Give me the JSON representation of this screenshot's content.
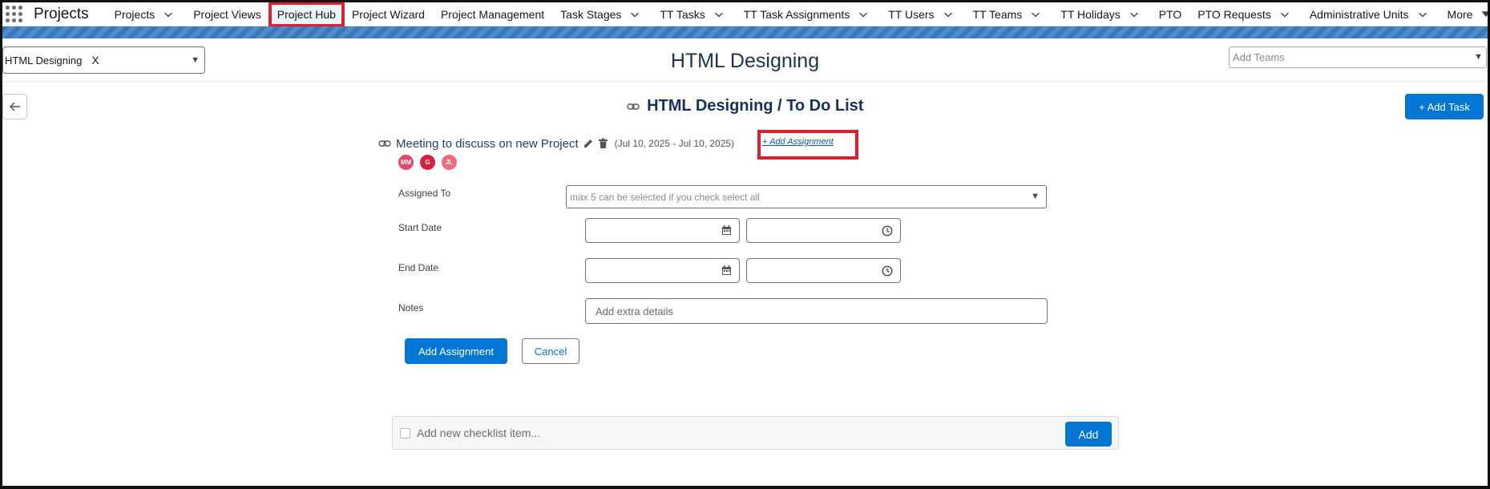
{
  "app": {
    "name": "Projects"
  },
  "nav": {
    "items": [
      {
        "label": "Projects",
        "dropdown": true
      },
      {
        "label": "Project Views",
        "dropdown": false
      },
      {
        "label": "Project Hub",
        "dropdown": false,
        "active": true,
        "highlighted": true
      },
      {
        "label": "Project Wizard",
        "dropdown": false
      },
      {
        "label": "Project Management",
        "dropdown": false
      },
      {
        "label": "Task Stages",
        "dropdown": true
      },
      {
        "label": "TT Tasks",
        "dropdown": true
      },
      {
        "label": "TT Task Assignments",
        "dropdown": true
      },
      {
        "label": "TT Users",
        "dropdown": true
      },
      {
        "label": "TT Teams",
        "dropdown": true
      },
      {
        "label": "TT Holidays",
        "dropdown": true
      },
      {
        "label": "PTO",
        "dropdown": false
      },
      {
        "label": "PTO Requests",
        "dropdown": true
      },
      {
        "label": "Administrative Units",
        "dropdown": true
      },
      {
        "label": "More",
        "dropdown": true
      }
    ]
  },
  "header": {
    "project_select_value": "HTML Designing",
    "project_select_clear": "X",
    "title": "HTML Designing",
    "teams_placeholder": "Add Teams"
  },
  "list": {
    "title": "HTML Designing  / To Do List",
    "add_task_label": "+ Add Task"
  },
  "task": {
    "name": "Meeting to discuss on new Project",
    "dates": "(Jul 10, 2025 - Jul 10, 2025)",
    "add_assignment_link": "+ Add Assignment",
    "assignees": [
      {
        "initials": "MM",
        "color": "#e8456b"
      },
      {
        "initials": "G",
        "color": "#d6203d"
      },
      {
        "initials": "JL",
        "color": "#ef6b7d"
      }
    ]
  },
  "form": {
    "assigned_to_label": "Assigned To",
    "assigned_to_placeholder": "max 5 can be selected if you check select all",
    "start_date_label": "Start Date",
    "end_date_label": "End Date",
    "notes_label": "Notes",
    "notes_placeholder": "Add extra details",
    "submit_label": "Add Assignment",
    "cancel_label": "Cancel"
  },
  "checklist": {
    "placeholder": "Add new checklist item...",
    "add_label": "Add"
  },
  "colors": {
    "brand": "#0176d3",
    "highlight": "#e01e2e",
    "heading": "#16325c"
  }
}
